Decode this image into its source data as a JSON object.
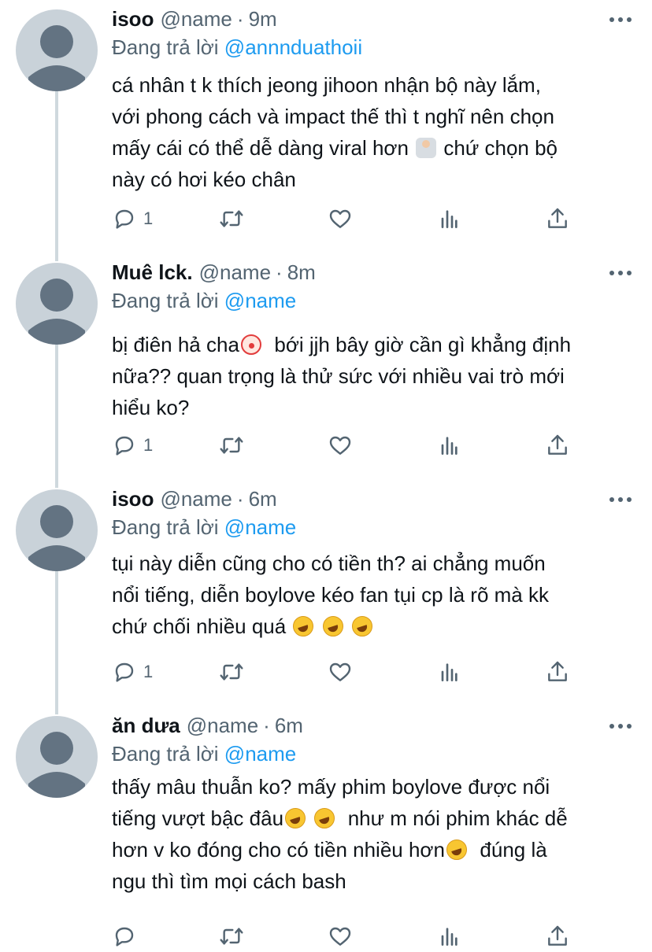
{
  "reply_prefix": "Đang trả lời",
  "tweets": [
    {
      "name": "isoo",
      "handle": "@name",
      "time": "9m",
      "reply_to": "@annnduathoii",
      "lines": [
        "cá nhân t k thích jeong jihoon nhận bộ này lắm,",
        "với phong cách và impact thế thì t nghĩ nên chọn",
        "mấy cái có thể dễ dàng viral hơn",
        "chứ chọn bộ",
        "này có hơi kéo chân"
      ],
      "reply_count": "1"
    },
    {
      "name": "Muê lck.",
      "handle": "@name",
      "time": "8m",
      "reply_to": "@name",
      "lines": [
        "bị điên hả cha",
        "bới jjh bây giờ cần gì khẳng định",
        "nữa?? quan trọng là thử sức với nhiều vai trò mới",
        "hiểu ko?"
      ],
      "reply_count": "1"
    },
    {
      "name": "isoo",
      "handle": "@name",
      "time": "6m",
      "reply_to": "@name",
      "lines": [
        "tụi này diễn cũng cho có tiền th? ai chẳng muốn",
        "nổi tiếng, diễn boylove kéo fan tụi cp là rõ mà kk",
        "chứ chối nhiều quá"
      ],
      "reply_count": "1"
    },
    {
      "name": "ăn dưa",
      "handle": "@name",
      "time": "6m",
      "reply_to": "@name",
      "lines": [
        "thấy mâu thuẫn ko? mấy phim boylove được nổi",
        "tiếng vượt bậc đâu",
        "như m nói phim khác dễ",
        "hơn v ko đóng cho có tiền nhiều hơn",
        "đúng là",
        "ngu thì tìm mọi cách bash"
      ],
      "reply_count": ""
    }
  ],
  "icons": {
    "reply": "reply-icon",
    "retweet": "retweet-icon",
    "like": "like-icon",
    "views": "views-icon",
    "share": "share-icon",
    "more": "more-icon",
    "avatar": "default-avatar-icon"
  },
  "colors": {
    "text": "#0f1419",
    "secondary": "#536471",
    "mention": "#1d9bf0",
    "thread_line": "#cfd9de",
    "avatar_bg": "#c9d2d9",
    "avatar_fg": "#637382"
  }
}
